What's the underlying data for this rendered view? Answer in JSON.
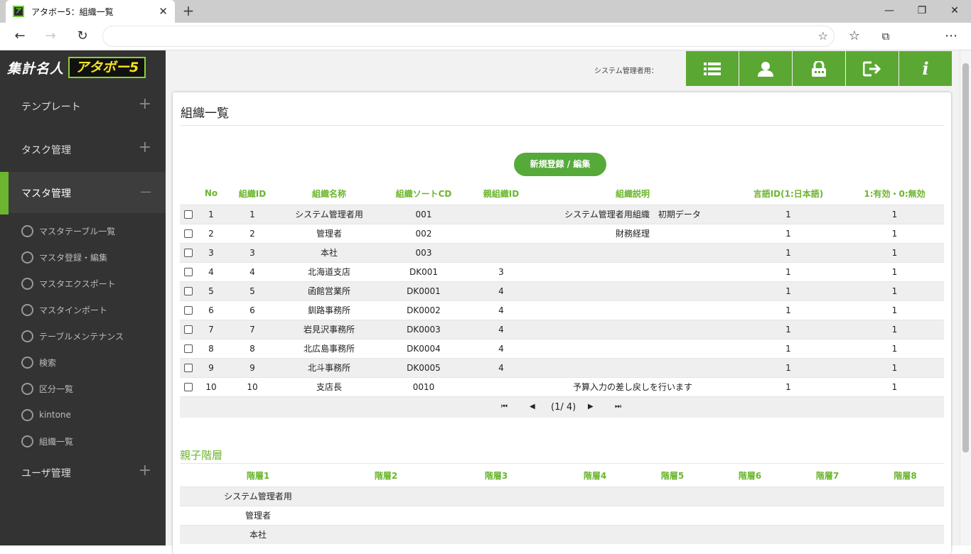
{
  "browser": {
    "tab_title": "アタボー5：組織一覧",
    "favicon_text": "ア",
    "tab_close": "✕",
    "new_tab": "+",
    "minimize": "—",
    "maximize": "❐",
    "close": "✕"
  },
  "sidebar": {
    "logo_text1": "集計名人",
    "logo_text2": "アタボー5",
    "menu": [
      {
        "label": "テンプレート"
      },
      {
        "label": "タスク管理"
      },
      {
        "label": "マスタ管理"
      },
      {
        "label": "ユーザ管理"
      }
    ],
    "plus": "+",
    "minus": "—",
    "sub_items": [
      "マスタテーブル一覧",
      "マスタ登録・編集",
      "マスタエクスポート",
      "マスタインポート",
      "テーブルメンテナンス",
      "検索",
      "区分一覧",
      "kintone",
      "組織一覧"
    ]
  },
  "header": {
    "system_user_label": "システム管理者用："
  },
  "page": {
    "title": "組織一覧",
    "register_button": "新規登録 / 編集",
    "columns": [
      "No",
      "組織ID",
      "組織名称",
      "組織ソートCD",
      "親組織ID",
      "組織説明",
      "言語ID(1:日本語)",
      "1:有効・0:無効"
    ],
    "rows": [
      [
        "1",
        "1",
        "システム管理者用",
        "001",
        "",
        "システム管理者用組織　初期データ",
        "1",
        "1"
      ],
      [
        "2",
        "2",
        "管理者",
        "002",
        "",
        "財務経理",
        "1",
        "1"
      ],
      [
        "3",
        "3",
        "本社",
        "003",
        "",
        "",
        "1",
        "1"
      ],
      [
        "4",
        "4",
        "北海道支店",
        "DK001",
        "3",
        "",
        "1",
        "1"
      ],
      [
        "5",
        "5",
        "函館営業所",
        "DK0001",
        "4",
        "",
        "1",
        "1"
      ],
      [
        "6",
        "6",
        "釧路事務所",
        "DK0002",
        "4",
        "",
        "1",
        "1"
      ],
      [
        "7",
        "7",
        "岩見沢事務所",
        "DK0003",
        "4",
        "",
        "1",
        "1"
      ],
      [
        "8",
        "8",
        "北広島事務所",
        "DK0004",
        "4",
        "",
        "1",
        "1"
      ],
      [
        "9",
        "9",
        "北斗事務所",
        "DK0005",
        "4",
        "",
        "1",
        "1"
      ],
      [
        "10",
        "10",
        "支店長",
        "0010",
        "",
        "予算入力の差し戻しを行います",
        "1",
        "1"
      ]
    ],
    "pager": {
      "first": "⏮",
      "prev": "◀",
      "info": "(1/ 4)",
      "next": "▶",
      "last": "⏭"
    },
    "hierarchy_title": "親子階層",
    "hierarchy_columns": [
      "階層1",
      "階層2",
      "階層3",
      "階層4",
      "階層5",
      "階層6",
      "階層7",
      "階層8"
    ],
    "hierarchy_rows": [
      "システム管理者用",
      "管理者",
      "本社"
    ]
  }
}
